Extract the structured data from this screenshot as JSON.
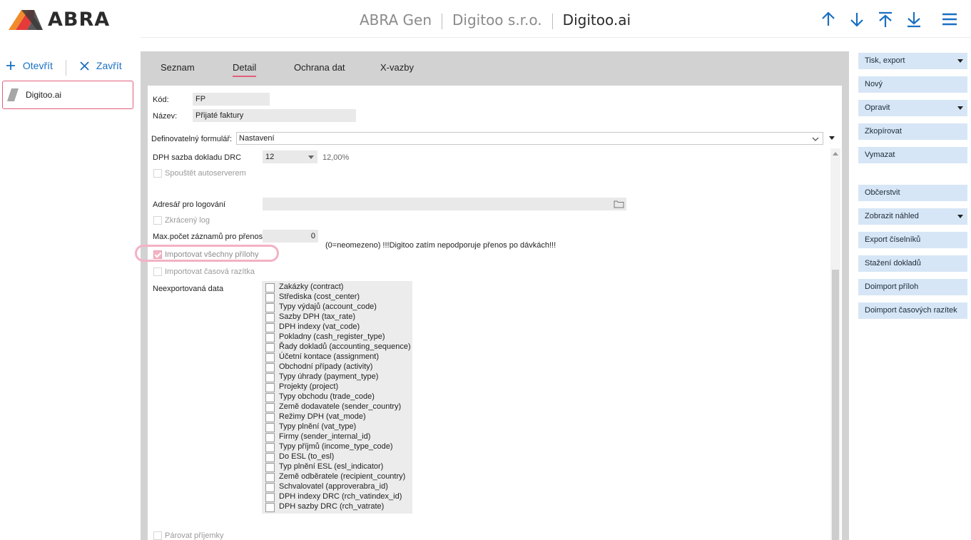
{
  "app": {
    "logo_text": "ABRA",
    "breadcrumbs": [
      "ABRA Gen",
      "Digitoo s.r.o.",
      "Digitoo.ai"
    ],
    "brand_color": "#1a6fc2",
    "accent_color": "#e0607a"
  },
  "left_panel": {
    "open_label": "Otevřít",
    "close_label": "Zavřít",
    "items": [
      {
        "label": "Digitoo.ai"
      }
    ]
  },
  "tabs": [
    {
      "label": "Seznam",
      "active": false
    },
    {
      "label": "Detail",
      "active": true
    },
    {
      "label": "Ochrana dat",
      "active": false
    },
    {
      "label": "X-vazby",
      "active": false
    }
  ],
  "form": {
    "code_label": "Kód:",
    "code_value": "FP",
    "name_label": "Název:",
    "name_value": "Přijaté faktury",
    "form_label": "Definovatelný formulář:",
    "form_value": "Nastavení",
    "vat_label": "DPH sazba dokladu DRC",
    "vat_value": "12",
    "vat_percent": "12,00%",
    "autoserver_label": "Spouštět autoserverem",
    "logdir_label": "Adresář pro logování",
    "shortlog_label": "Zkrácený log",
    "max_label": "Max.počet záznamů pro přenos",
    "max_value": "0",
    "max_note": "(0=neomezeno) !!!Digitoo zatím nepodporuje přenos po dávkách!!!",
    "import_all_label": "Importovat všechny přílohy",
    "import_timestamps_label": "Importovat časová razítka",
    "nonexported_label": "Neexportovaná data",
    "pair_label": "Párovat příjemky"
  },
  "nonexported_items": [
    "Zakázky (contract)",
    "Střediska (cost_center)",
    "Typy výdajů (account_code)",
    "Sazby DPH (tax_rate)",
    "DPH indexy (vat_code)",
    "Pokladny (cash_register_type)",
    "Řady dokladů (accounting_sequence)",
    "Účetní kontace (assignment)",
    "Obchodní případy (activity)",
    "Typy úhrady (payment_type)",
    "Projekty (project)",
    "Typy obchodu (trade_code)",
    "Země dodavatele (sender_country)",
    "Režimy DPH (vat_mode)",
    "Typy plnění (vat_type)",
    "Firmy (sender_internal_id)",
    "Typy příjmů (income_type_code)",
    "Do ESL (to_esl)",
    "Typ plnění ESL (esl_indicator)",
    "Země odběratele (recipient_country)",
    "Schvalovatel (approverabra_id)",
    "DPH indexy DRC (rch_vatindex_id)",
    "DPH sazby DRC (rch_vatrate)"
  ],
  "right_buttons": [
    {
      "label": "Tisk, export",
      "dropdown": true
    },
    {
      "label": "Nový",
      "dropdown": false
    },
    {
      "label": "Opravit",
      "dropdown": true
    },
    {
      "label": "Zkopírovat",
      "dropdown": false
    },
    {
      "label": "Vymazat",
      "dropdown": false
    },
    {
      "label": "Občerstvit",
      "dropdown": false
    },
    {
      "label": "Zobrazit náhled",
      "dropdown": true
    },
    {
      "label": "Export číselníků",
      "dropdown": false
    },
    {
      "label": "Stažení dokladů",
      "dropdown": false
    },
    {
      "label": "Doimport příloh",
      "dropdown": false
    },
    {
      "label": "Doimport časových razítek",
      "dropdown": false
    }
  ]
}
